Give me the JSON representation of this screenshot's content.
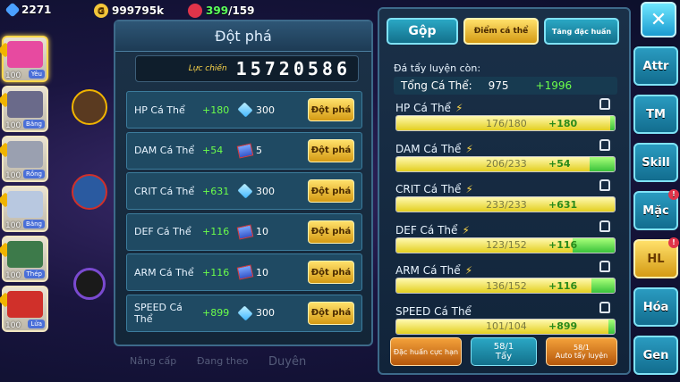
{
  "resources": {
    "gems": "2271",
    "gold": "999795k",
    "energy_current": "399",
    "energy_sep": "/159"
  },
  "roster": [
    {
      "level": "100",
      "tag": "Yêu",
      "color": "#e74aa0"
    },
    {
      "level": "100",
      "tag": "Băng",
      "color": "#6a6a8a"
    },
    {
      "level": "100",
      "tag": "Rồng",
      "color": "#9aa0b0"
    },
    {
      "level": "100",
      "tag": "Băng",
      "color": "#b8c8e0"
    },
    {
      "level": "100",
      "tag": "Thép",
      "color": "#3d7a4a"
    },
    {
      "level": "100",
      "tag": "Lửa",
      "color": "#d0302a"
    }
  ],
  "breakthrough": {
    "title": "Đột phá",
    "power_label": "Lực chiến",
    "power_value": "15720586",
    "button_label": "Đột phá",
    "rows": [
      {
        "name": "HP Cá Thể",
        "bonus": "+180",
        "cost": "300",
        "icon": "gem-icon"
      },
      {
        "name": "DAM Cá Thể",
        "bonus": "+54",
        "cost": "5",
        "icon": "book-icon"
      },
      {
        "name": "CRIT Cá Thể",
        "bonus": "+631",
        "cost": "300",
        "icon": "gem-icon"
      },
      {
        "name": "DEF Cá Thể",
        "bonus": "+116",
        "cost": "10",
        "icon": "book-icon"
      },
      {
        "name": "ARM Cá Thể",
        "bonus": "+116",
        "cost": "10",
        "icon": "book-icon"
      },
      {
        "name": "SPEED Cá Thể",
        "bonus": "+899",
        "cost": "300",
        "icon": "gem-icon"
      }
    ]
  },
  "ghost_labels": [
    "Nâng cấp",
    "Đang theo",
    "Duyên"
  ],
  "individual": {
    "tabs": {
      "merge": "Gộp",
      "individual": "Điểm cá thể",
      "gift": "Tăng đặc huấn"
    },
    "remain_label": "Đá tẩy luyện còn:",
    "total_label": "Tổng Cá Thể:",
    "total_value": "975",
    "total_plus": "+1996",
    "stats": [
      {
        "name": "HP Cá Thể",
        "cur": 176,
        "max": 180,
        "cur_text": "176/180",
        "plus": "+180",
        "bolt": true
      },
      {
        "name": "DAM Cá Thể",
        "cur": 206,
        "max": 233,
        "cur_text": "206/233",
        "plus": "+54",
        "bolt": true
      },
      {
        "name": "CRIT Cá Thể",
        "cur": 233,
        "max": 233,
        "cur_text": "233/233",
        "plus": "+631",
        "bolt": true
      },
      {
        "name": "DEF Cá Thể",
        "cur": 123,
        "max": 152,
        "cur_text": "123/152",
        "plus": "+116",
        "bolt": true
      },
      {
        "name": "ARM Cá Thể",
        "cur": 136,
        "max": 152,
        "cur_text": "136/152",
        "plus": "+116",
        "bolt": true
      },
      {
        "name": "SPEED Cá Thể",
        "cur": 101,
        "max": 104,
        "cur_text": "101/104",
        "plus": "+899",
        "bolt": false
      }
    ],
    "buttons": {
      "train": "Đặc huấn cực hạn",
      "wash_count": "58/1",
      "wash": "Tẩy",
      "auto_count": "58/1",
      "auto": "Auto tẩy luyện"
    }
  },
  "side_tabs": [
    {
      "label": "Attr",
      "active": false,
      "alert": false
    },
    {
      "label": "TM",
      "active": false,
      "alert": false
    },
    {
      "label": "Skill",
      "active": false,
      "alert": false
    },
    {
      "label": "Mặc",
      "active": false,
      "alert": true
    },
    {
      "label": "HL",
      "active": true,
      "alert": true
    },
    {
      "label": "Hóa",
      "active": false,
      "alert": false
    },
    {
      "label": "Gen",
      "active": false,
      "alert": false
    }
  ]
}
